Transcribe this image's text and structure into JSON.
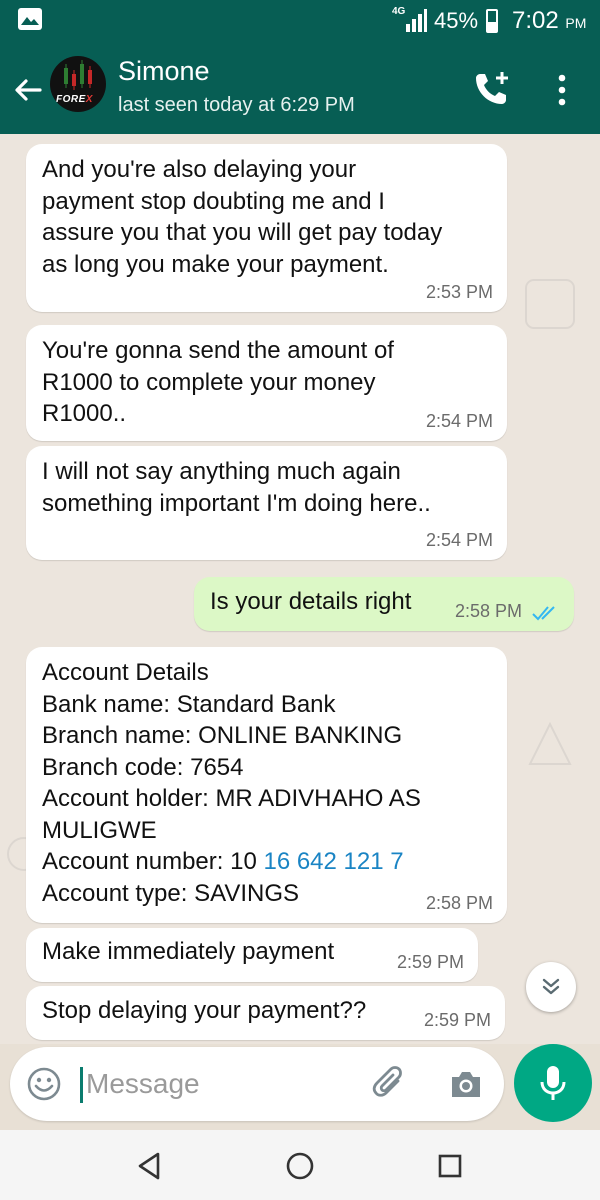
{
  "status_bar": {
    "network": "4G",
    "battery_percent": "45%",
    "battery_level": 0.45,
    "time": "7:02",
    "time_suffix": "PM"
  },
  "header": {
    "contact_name": "Simone",
    "last_seen": "last seen today at 6:29 PM",
    "avatar_text": "FORE",
    "avatar_text_accent": "X"
  },
  "messages": [
    {
      "direction": "in",
      "text": "And you're also delaying your\npayment stop doubting me and I\nassure you that you will get pay today\nas long you make your payment.",
      "time": "2:53 PM"
    },
    {
      "direction": "in",
      "text": "You're gonna send the amount of\nR1000 to complete your money\nR1000..",
      "time": "2:54 PM"
    },
    {
      "direction": "in",
      "text": "I will not say anything much again\nsomething important I'm doing here..",
      "time": "2:54 PM"
    },
    {
      "direction": "out",
      "text": "Is your details right",
      "time": "2:58 PM",
      "status": "read"
    },
    {
      "direction": "in",
      "lines": [
        "Account Details",
        "Bank name: Standard Bank",
        "Branch name: ONLINE BANKING",
        "Branch code: 7654",
        "Account holder: MR ADIVHAHO AS",
        "MULIGWE"
      ],
      "account_number_label": "Account number: 10 ",
      "account_number_link": "16 642 121 7",
      "account_type": "Account type: SAVINGS",
      "time": "2:58 PM"
    },
    {
      "direction": "in",
      "text": "Make immediately payment",
      "time": "2:59 PM"
    },
    {
      "direction": "in",
      "text": "Stop delaying your payment??",
      "time": "2:59 PM"
    }
  ],
  "composer": {
    "placeholder": "Message"
  },
  "colors": {
    "header": "#075e54",
    "accent": "#00a884",
    "outgoing_bubble": "#dcf8c6",
    "read_ticks": "#34b7f1",
    "link": "#1a84c4"
  },
  "icons": {
    "status_left": "gallery-icon",
    "back": "arrow-left-icon",
    "call_add": "add-call-icon",
    "menu": "kebab-menu-icon",
    "emoji": "emoji-icon",
    "attach": "paperclip-icon",
    "camera": "camera-icon",
    "mic": "microphone-icon",
    "scroll": "double-chevron-down-icon"
  }
}
